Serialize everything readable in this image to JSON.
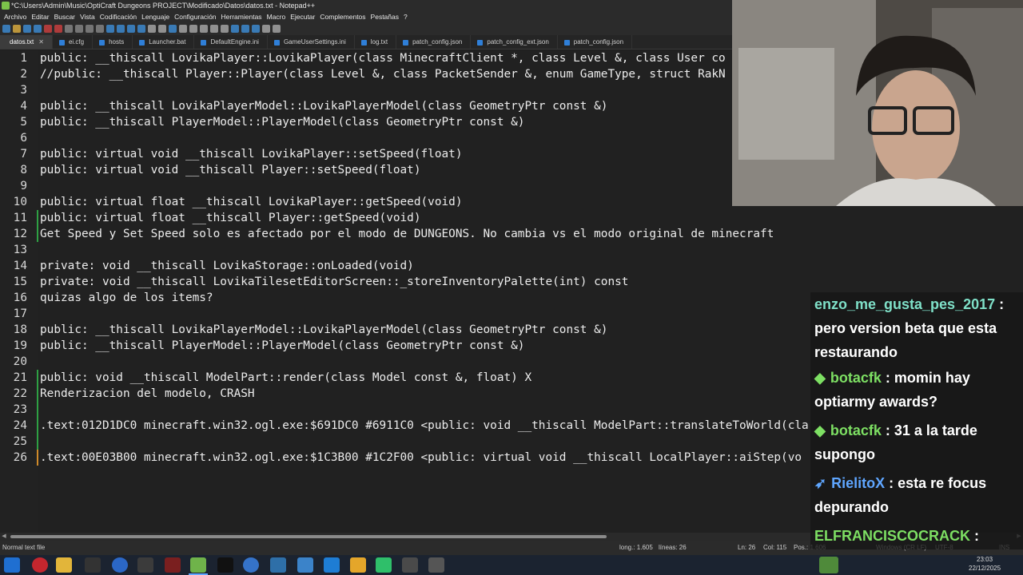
{
  "window": {
    "title": "*C:\\Users\\Admin\\Music\\OptiCraft Dungeons PROJECT\\Modificado\\Datos\\datos.txt - Notepad++"
  },
  "menu": [
    "Archivo",
    "Editar",
    "Buscar",
    "Vista",
    "Codificación",
    "Lenguaje",
    "Configuración",
    "Herramientas",
    "Macro",
    "Ejecutar",
    "Complementos",
    "Pestañas",
    "?"
  ],
  "tabs": [
    {
      "label": "datos.txt",
      "active": true
    },
    {
      "label": "ei.cfg"
    },
    {
      "label": "hosts"
    },
    {
      "label": "Launcher.bat"
    },
    {
      "label": "DefaultEngine.ini"
    },
    {
      "label": "GameUserSettings.ini"
    },
    {
      "label": "log.txt"
    },
    {
      "label": "patch_config.json"
    },
    {
      "label": "patch_config_ext.json"
    },
    {
      "label": "patch_config.json"
    }
  ],
  "tab_close": "✕",
  "editor": {
    "lines": [
      {
        "num": "1",
        "text": "public: __thiscall LovikaPlayer::LovikaPlayer(class MinecraftClient *, class Level &, class User co"
      },
      {
        "num": "2",
        "text": "//public: __thiscall Player::Player(class Level &, class PacketSender &, enum GameType, struct RakN"
      },
      {
        "num": "3",
        "text": ""
      },
      {
        "num": "4",
        "text": "public: __thiscall LovikaPlayerModel::LovikaPlayerModel(class GeometryPtr const &)"
      },
      {
        "num": "5",
        "text": "public: __thiscall PlayerModel::PlayerModel(class GeometryPtr const &)"
      },
      {
        "num": "6",
        "text": ""
      },
      {
        "num": "7",
        "text": "public: virtual void __thiscall LovikaPlayer::setSpeed(float)"
      },
      {
        "num": "8",
        "text": "public: virtual void __thiscall Player::setSpeed(float)"
      },
      {
        "num": "9",
        "text": ""
      },
      {
        "num": "10",
        "text": "public: virtual float __thiscall LovikaPlayer::getSpeed(void)"
      },
      {
        "num": "11",
        "text": "public: virtual float __thiscall Player::getSpeed(void)",
        "mark": "green"
      },
      {
        "num": "12",
        "text": "Get Speed y Set Speed solo es afectado por el modo de DUNGEONS. No cambia vs el modo original de minecraft",
        "mark": "green"
      },
      {
        "num": "13",
        "text": ""
      },
      {
        "num": "14",
        "text": "private: void __thiscall LovikaStorage::onLoaded(void)"
      },
      {
        "num": "15",
        "text": "private: void __thiscall LovikaTilesetEditorScreen::_storeInventoryPalette(int) const"
      },
      {
        "num": "16",
        "text": "quizas algo de los items?"
      },
      {
        "num": "17",
        "text": ""
      },
      {
        "num": "18",
        "text": "public: __thiscall LovikaPlayerModel::LovikaPlayerModel(class GeometryPtr const &)"
      },
      {
        "num": "19",
        "text": "public: __thiscall PlayerModel::PlayerModel(class GeometryPtr const &)"
      },
      {
        "num": "20",
        "text": ""
      },
      {
        "num": "21",
        "text": "public: void __thiscall ModelPart::render(class Model const &, float) X",
        "mark": "green"
      },
      {
        "num": "22",
        "text": "Renderizacion del modelo, CRASH",
        "mark": "green"
      },
      {
        "num": "23",
        "text": "",
        "mark": "green"
      },
      {
        "num": "24",
        "text": ".text:012D1DC0 minecraft.win32.ogl.exe:$691DC0 #6911C0 <public: void __thiscall ModelPart::translateToWorld(cla",
        "mark": "green"
      },
      {
        "num": "25",
        "text": "",
        "mark": "green"
      },
      {
        "num": "26",
        "text": ".text:00E03B00 minecraft.win32.ogl.exe:$1C3B00 #1C2F00 <public: virtual void __thiscall LocalPlayer::aiStep(vo",
        "mark": "orange"
      }
    ]
  },
  "status": {
    "file_type": "Normal text file",
    "length": "long.: 1.605",
    "lines": "líneas: 26",
    "ln": "Ln: 26",
    "col": "Col: 115",
    "pos": "Pos.: 1.606",
    "eol": "Windows (CR LF)",
    "encoding": "UTF-8",
    "ins": "INS"
  },
  "taskbar": {
    "time": "23:03",
    "date": "22/12/2025"
  },
  "chat": {
    "messages": [
      {
        "user": "enzo_me_gusta_pes_2017",
        "user_color": "#7fe0c8",
        "text": ": pero version beta que esta restaurando"
      },
      {
        "user": "botacfk",
        "user_color": "#7ddf63",
        "badge": "◆",
        "badge_color": "#7ddf63",
        "text": ": momin hay optiarmy awards?"
      },
      {
        "user": "botacfk",
        "user_color": "#7ddf63",
        "badge": "◆",
        "badge_color": "#7ddf63",
        "text": ": 31 a la tarde supongo"
      },
      {
        "user": "RielitoX",
        "user_color": "#5fa6ff",
        "badge": "➶",
        "badge_color": "#5fa6ff",
        "text": ": esta re focus depurando"
      },
      {
        "user": "ELFRANCISCOCRACK",
        "user_color": "#7ddf63",
        "text": ":"
      }
    ]
  },
  "colors": {
    "editor_bg": "#212121",
    "text": "#ececec",
    "change_green": "#2ea043",
    "change_orange": "#d08a2a"
  }
}
